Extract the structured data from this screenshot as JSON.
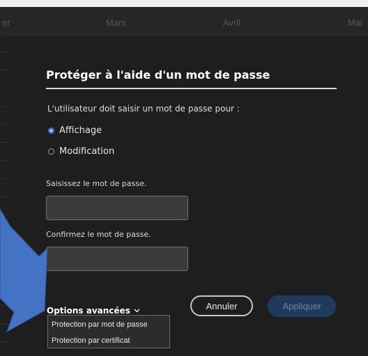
{
  "calendar": {
    "months": [
      "er",
      "Mars",
      "Avril",
      "Mai"
    ]
  },
  "dialog": {
    "title": "Protéger à l'aide d'un mot de passe",
    "prompt": "L'utilisateur doit saisir un mot de passe pour :",
    "radio_options": [
      {
        "label": "Affichage",
        "checked": true
      },
      {
        "label": "Modification",
        "checked": false
      }
    ],
    "password_label": "Saisissez le mot de passe.",
    "password_value": "",
    "confirm_label": "Confirmez le mot de passe.",
    "confirm_value": "",
    "advanced_label": "Options avancées",
    "cancel_label": "Annuler",
    "apply_label": "Appliquer",
    "apply_enabled": false
  },
  "advanced_menu": {
    "items": [
      "Protection par mot de passe",
      "Protection par certificat"
    ]
  },
  "colors": {
    "accent": "#3a78d6",
    "dialog_background": "#1e1e1e",
    "annotation_arrow": "#4472c4"
  },
  "icons": {
    "advanced_toggle": "chevron-down-icon",
    "annotation": "arrow-icon"
  }
}
